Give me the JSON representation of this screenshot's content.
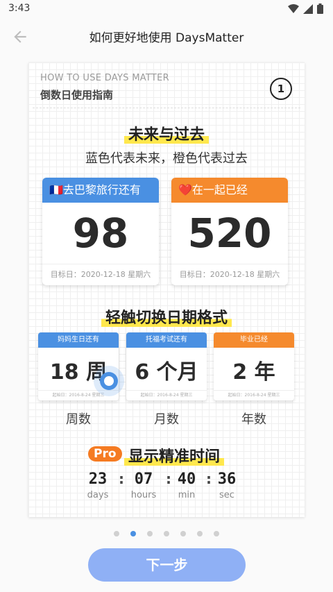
{
  "status": {
    "time": "3:43"
  },
  "appbar": {
    "title": "如何更好地使用 DaysMatter"
  },
  "card": {
    "eyebrow": "HOW TO USE DAYS MATTER",
    "subtitle": "倒数日使用指南",
    "page_number": "1",
    "section1": {
      "heading": "未来与过去",
      "desc": "蓝色代表未来，橙色代表过去",
      "items": [
        {
          "label": "🇫🇷去巴黎旅行还有",
          "value": "98",
          "footer": "目标日：2020-12-18 星期六",
          "color": "#4a90e2"
        },
        {
          "label": "❤️在一起已经",
          "value": "520",
          "footer": "目标日：2020-12-18 星期六",
          "color": "#f58a2d"
        }
      ]
    },
    "section2": {
      "heading": "轻触切换日期格式",
      "items": [
        {
          "label": "妈妈生日还有",
          "value": "18 周",
          "footer": "起始日：2016-8-24 星期三",
          "unit": "周数",
          "color": "#4a90e2"
        },
        {
          "label": "托福考试还有",
          "value": "6 个月",
          "footer": "起始日：2016-8-24 星期三",
          "unit": "月数",
          "color": "#4a90e2"
        },
        {
          "label": "毕业已经",
          "value": "2 年",
          "footer": "起始日：2016-8-24 星期三",
          "unit": "年数",
          "color": "#f58a2d"
        }
      ]
    },
    "section3": {
      "badge": "Pro",
      "heading": "显示精准时间",
      "timer": [
        {
          "value": "23",
          "label": "days"
        },
        {
          "value": "07",
          "label": "hours"
        },
        {
          "value": "40",
          "label": "min"
        },
        {
          "value": "36",
          "label": "sec"
        }
      ]
    }
  },
  "pager": {
    "count": 7,
    "active_index": 1
  },
  "next_button": {
    "label": "下一步"
  }
}
